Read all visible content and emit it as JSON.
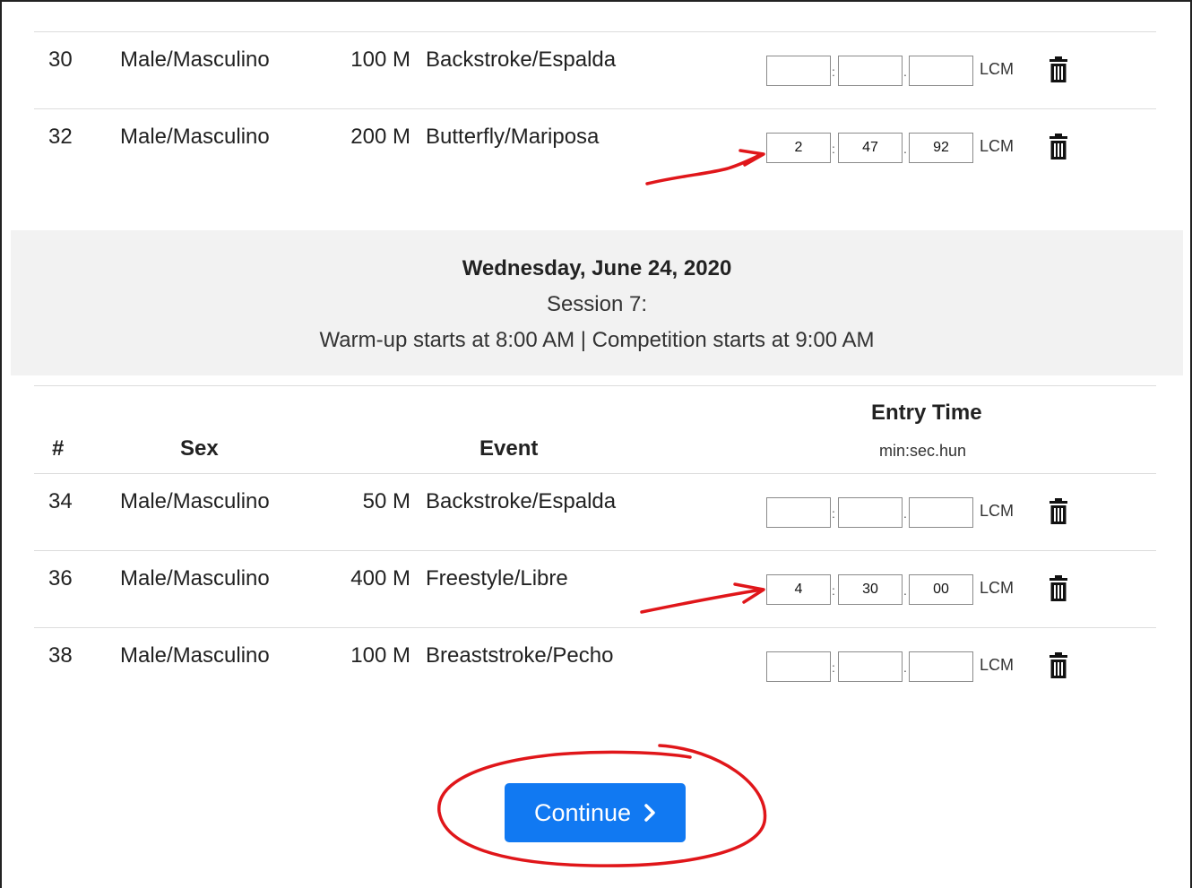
{
  "session": {
    "date": "Wednesday, June 24, 2020",
    "name": "Session 7:",
    "times": "Warm-up starts at 8:00 AM | Competition starts at 9:00 AM"
  },
  "table_header": {
    "num": "#",
    "sex": "Sex",
    "event": "Event",
    "entry_time": "Entry Time",
    "format": "min:sec.hun"
  },
  "events_top": [
    {
      "num": "30",
      "sex": "Male/Masculino",
      "distance": "100 M",
      "stroke": "Backstroke/Espalda",
      "min": "",
      "sec": "",
      "hun": "",
      "course": "LCM"
    },
    {
      "num": "32",
      "sex": "Male/Masculino",
      "distance": "200 M",
      "stroke": "Butterfly/Mariposa",
      "min": "2",
      "sec": "47",
      "hun": "92",
      "course": "LCM"
    }
  ],
  "events_bottom": [
    {
      "num": "34",
      "sex": "Male/Masculino",
      "distance": "50 M",
      "stroke": "Backstroke/Espalda",
      "min": "",
      "sec": "",
      "hun": "",
      "course": "LCM"
    },
    {
      "num": "36",
      "sex": "Male/Masculino",
      "distance": "400 M",
      "stroke": "Freestyle/Libre",
      "min": "4",
      "sec": "30",
      "hun": "00",
      "course": "LCM"
    },
    {
      "num": "38",
      "sex": "Male/Masculino",
      "distance": "100 M",
      "stroke": "Breaststroke/Pecho",
      "min": "",
      "sec": "",
      "hun": "",
      "course": "LCM"
    }
  ],
  "separators": {
    "colon": ":",
    "dot": "."
  },
  "continue_label": "Continue",
  "icons": {
    "delete": "trash-icon",
    "continue": "chevron-right-icon"
  },
  "colors": {
    "primary": "#1179f2",
    "annotation": "#e0161a",
    "session_bg": "#f2f2f2"
  }
}
